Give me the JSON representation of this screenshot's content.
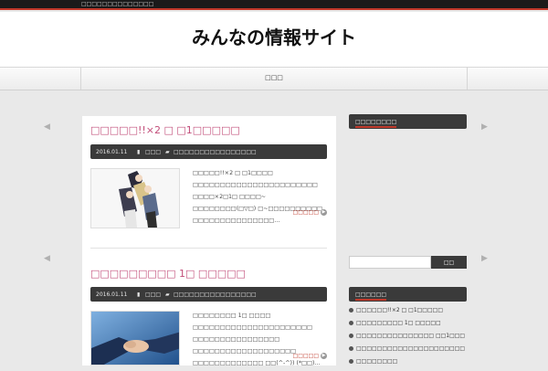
{
  "topbar": {
    "tagline": "□□□□□□□□□□□□□□"
  },
  "header": {
    "site_title": "みんなの情報サイト"
  },
  "nav": {
    "home_label": "□□□"
  },
  "posts": [
    {
      "title": "□□□□□!!×2 □ □1□□□□□",
      "date": "2016.01.11",
      "author": "□□□",
      "category": "□□□□□□□□□□□□□□□□",
      "excerpt": "□□□□□!!×2 □ □1□□□□ □□□□□□□□□□□□□□□□□□□□□□□ □□□□×2□1□ □□□□~ □□□□□□□□(□▽□) □~□□□□□□□□□□ □□□□□□□□□□□□□□□…",
      "more": "□□□□□"
    },
    {
      "title": "□□□□□□□□□ 1□ □□□□□",
      "date": "2016.01.11",
      "author": "□□□",
      "category": "□□□□□□□□□□□□□□□□",
      "excerpt": "□□□□□□□□ 1□ □□□□ □□□□□□□□□□□□□□□□□□□□□□ □□□□□□□□□□□□□□□□ □□□□□□□□□□□□□□□□□□□ □□□□□□□□□□□□□ □□(^-^)) (*□□)…",
      "more": "□□□□□"
    }
  ],
  "sidebar": {
    "widget1_title": "□□□□□□□□",
    "search_placeholder": "",
    "search_button": "□□",
    "widget2_title": "□□□□□□",
    "recent": [
      "□□□□□□!!×2 □ □1□□□□□",
      "□□□□□□□□□ 1□ □□□□□",
      "□□□□□□□□□□□□□□□ □□1□□□",
      "□□□□□□□□□□□□□□□□□□□□□",
      "□□□□□□□□"
    ]
  }
}
